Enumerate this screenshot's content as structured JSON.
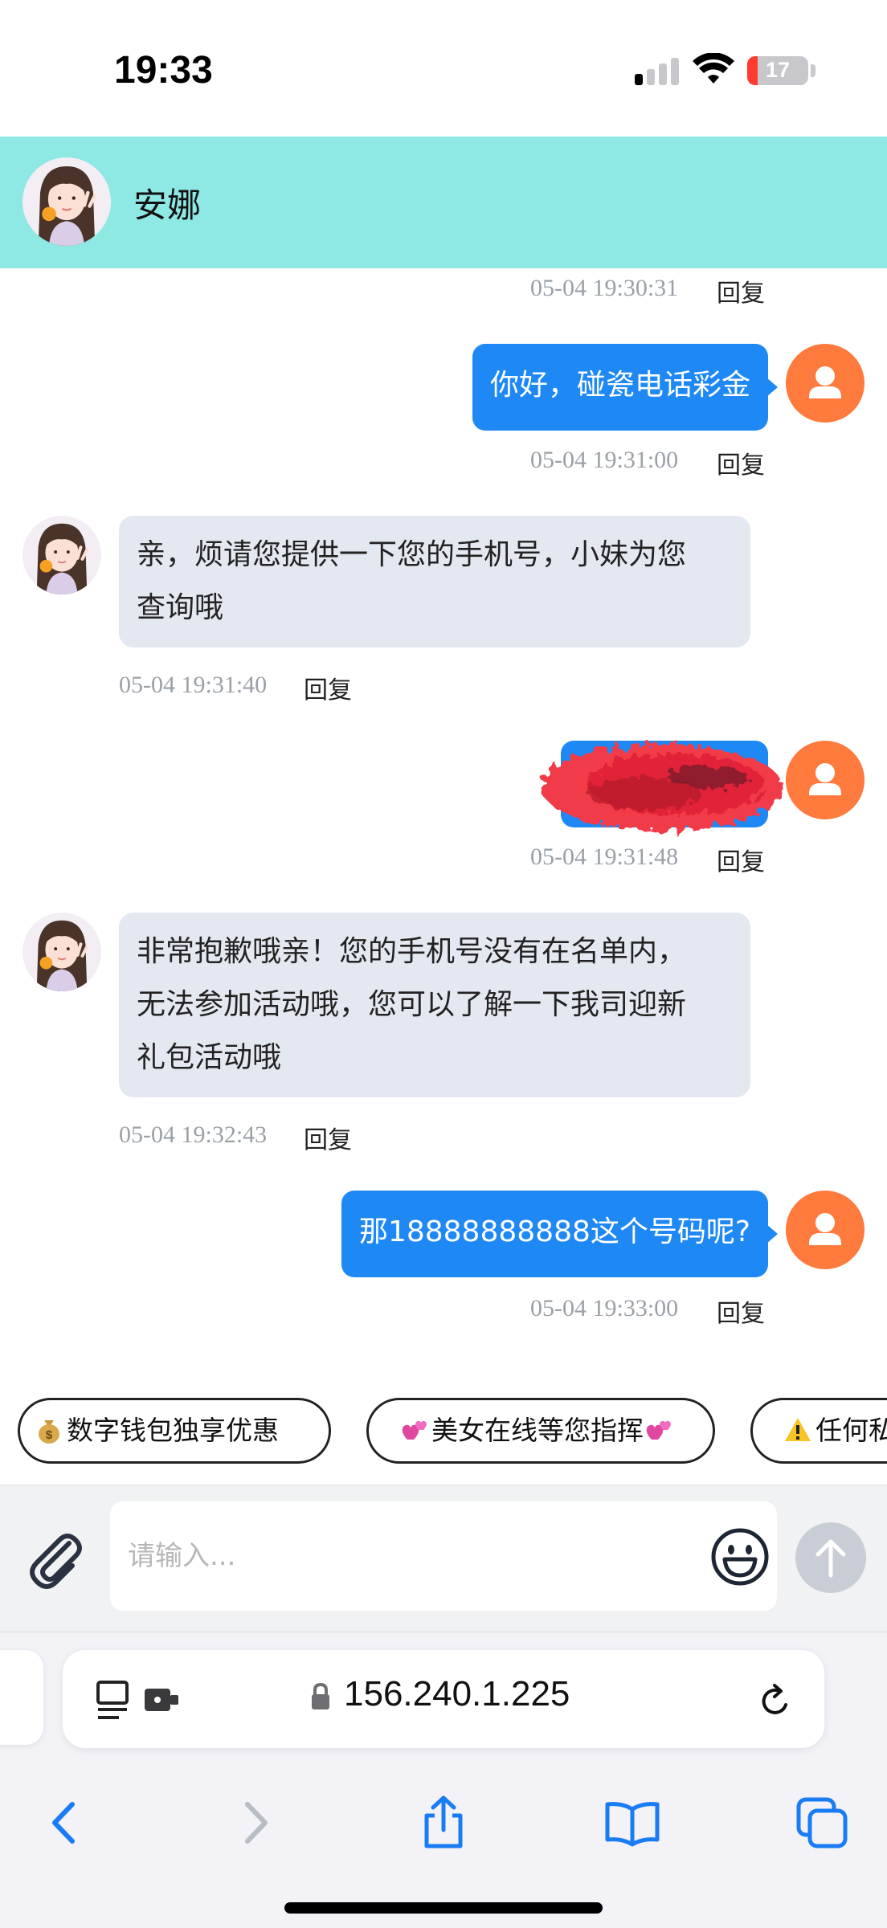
{
  "status_bar": {
    "time": "19:33",
    "battery": "17",
    "battery_level": 0.17,
    "signal_bars_active": 1,
    "signal_bars_total": 4
  },
  "header": {
    "contact_name": "安娜"
  },
  "messages": [
    {
      "timestamp": "05-04 19:30:31",
      "reply": "回复"
    },
    {
      "direction": "out",
      "text": "你好，碰瓷电话彩金",
      "timestamp": "05-04 19:31:00",
      "reply": "回复"
    },
    {
      "direction": "in",
      "lines": [
        "亲，烦请您提供一下您的手机号，小妹为您",
        "查询哦"
      ],
      "timestamp": "05-04 19:31:40",
      "reply": "回复"
    },
    {
      "direction": "out",
      "text": "",
      "redacted": true,
      "timestamp": "05-04 19:31:48",
      "reply": "回复"
    },
    {
      "direction": "in",
      "lines": [
        "非常抱歉哦亲！您的手机号没有在名单内，",
        "无法参加活动哦，您可以了解一下我司迎新",
        "礼包活动哦"
      ],
      "timestamp": "05-04 19:32:43",
      "reply": "回复"
    },
    {
      "direction": "out",
      "text": "那18888888888这个号码呢?",
      "timestamp": "05-04 19:33:00",
      "reply": "回复"
    }
  ],
  "quick_replies": [
    {
      "label": "数字钱包独享优惠",
      "icon": "money-bag-icon"
    },
    {
      "label": "美女在线等您指挥",
      "icon": "two-hearts-icon"
    },
    {
      "label": "任何私",
      "icon": "warning-icon"
    }
  ],
  "input": {
    "placeholder": "请输入..."
  },
  "browser": {
    "url": "156.240.1.225"
  },
  "colors": {
    "header_bg": "#8ee8e4",
    "bubble_out": "#1e88f5",
    "bubble_in": "#e4e8f1",
    "user_avatar": "#ff7a3d",
    "safari_blue": "#1a7cf5"
  }
}
